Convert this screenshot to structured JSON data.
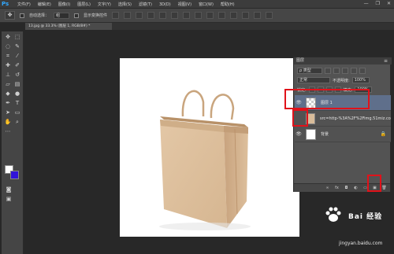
{
  "app": {
    "logo": "Ps"
  },
  "menu": [
    "文件(F)",
    "编辑(E)",
    "图像(I)",
    "图层(L)",
    "文字(Y)",
    "选择(S)",
    "滤镜(T)",
    "3D(D)",
    "视图(V)",
    "窗口(W)",
    "帮助(H)"
  ],
  "window_controls": [
    "—",
    "❐",
    "✕"
  ],
  "options_bar": {
    "auto_select_label": "自动选择：",
    "auto_select_value": "组",
    "show_transform_label": "显示变换控件"
  },
  "document_tab": {
    "title": "13.jpg @ 33.3% (图层 1, RGB/8#) *"
  },
  "layers_panel": {
    "title": "图层",
    "kind_filter": "ρ 类型",
    "blend_mode": "正常",
    "opacity_label": "不透明度:",
    "opacity_value": "100%",
    "lock_label": "锁定:",
    "fill_label": "填充:",
    "fill_value": "100%",
    "layers": [
      {
        "name": "图层 1",
        "selected": true
      },
      {
        "name": "src=http-%3A%2F%2Fimg.51miz.co...",
        "selected": false
      },
      {
        "name": "背景",
        "selected": false
      }
    ]
  },
  "colors": {
    "foreground": "#ffffff",
    "background": "#3214d8",
    "annotation": "#e0121a"
  },
  "watermark": {
    "text": "Bai 经验",
    "url": "jingyan.baidu.com"
  }
}
